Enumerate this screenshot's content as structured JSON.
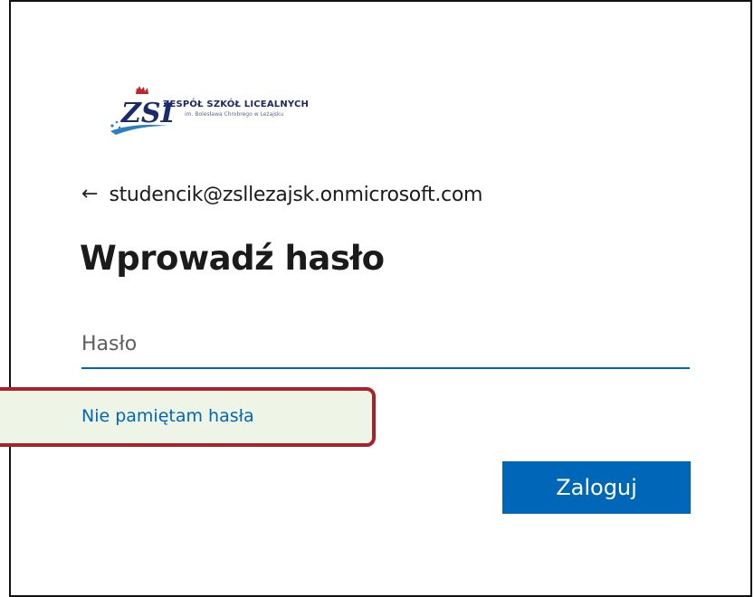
{
  "logo": {
    "title": "ZESPÓŁ SZKÓŁ LICEALNYCH",
    "subtitle": "im. Bolesława Chrobrego w Leżajsku",
    "mark_text": "ZSL"
  },
  "identity": {
    "back_glyph": "←",
    "email": "studencik@zsllezajsk.onmicrosoft.com"
  },
  "heading": "Wprowadź hasło",
  "password": {
    "placeholder": "Hasło",
    "value": ""
  },
  "links": {
    "forgot_password": "Nie pamiętam hasła"
  },
  "buttons": {
    "sign_in": "Zaloguj"
  },
  "colors": {
    "accent": "#0067b8",
    "highlight_border": "#a8222b",
    "highlight_fill": "#eef5e6"
  }
}
